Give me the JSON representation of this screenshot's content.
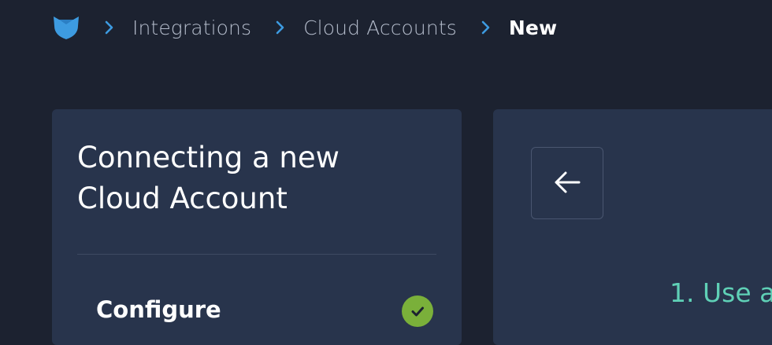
{
  "breadcrumb": {
    "logo_icon": "paw-logo-icon",
    "items": [
      {
        "label": "Integrations"
      },
      {
        "label": "Cloud Accounts"
      },
      {
        "label": "New"
      }
    ]
  },
  "left_panel": {
    "title": "Connecting a new Cloud Account",
    "steps": [
      {
        "label": "Configure",
        "status": "complete"
      }
    ]
  },
  "right_panel": {
    "back_icon": "arrow-left-icon",
    "step_text": "1. Use a"
  },
  "colors": {
    "background": "#1c2230",
    "panel": "#28344c",
    "accent_blue": "#3d9be0",
    "success_green": "#7ab03a",
    "teal_text": "#5fd0b6"
  }
}
